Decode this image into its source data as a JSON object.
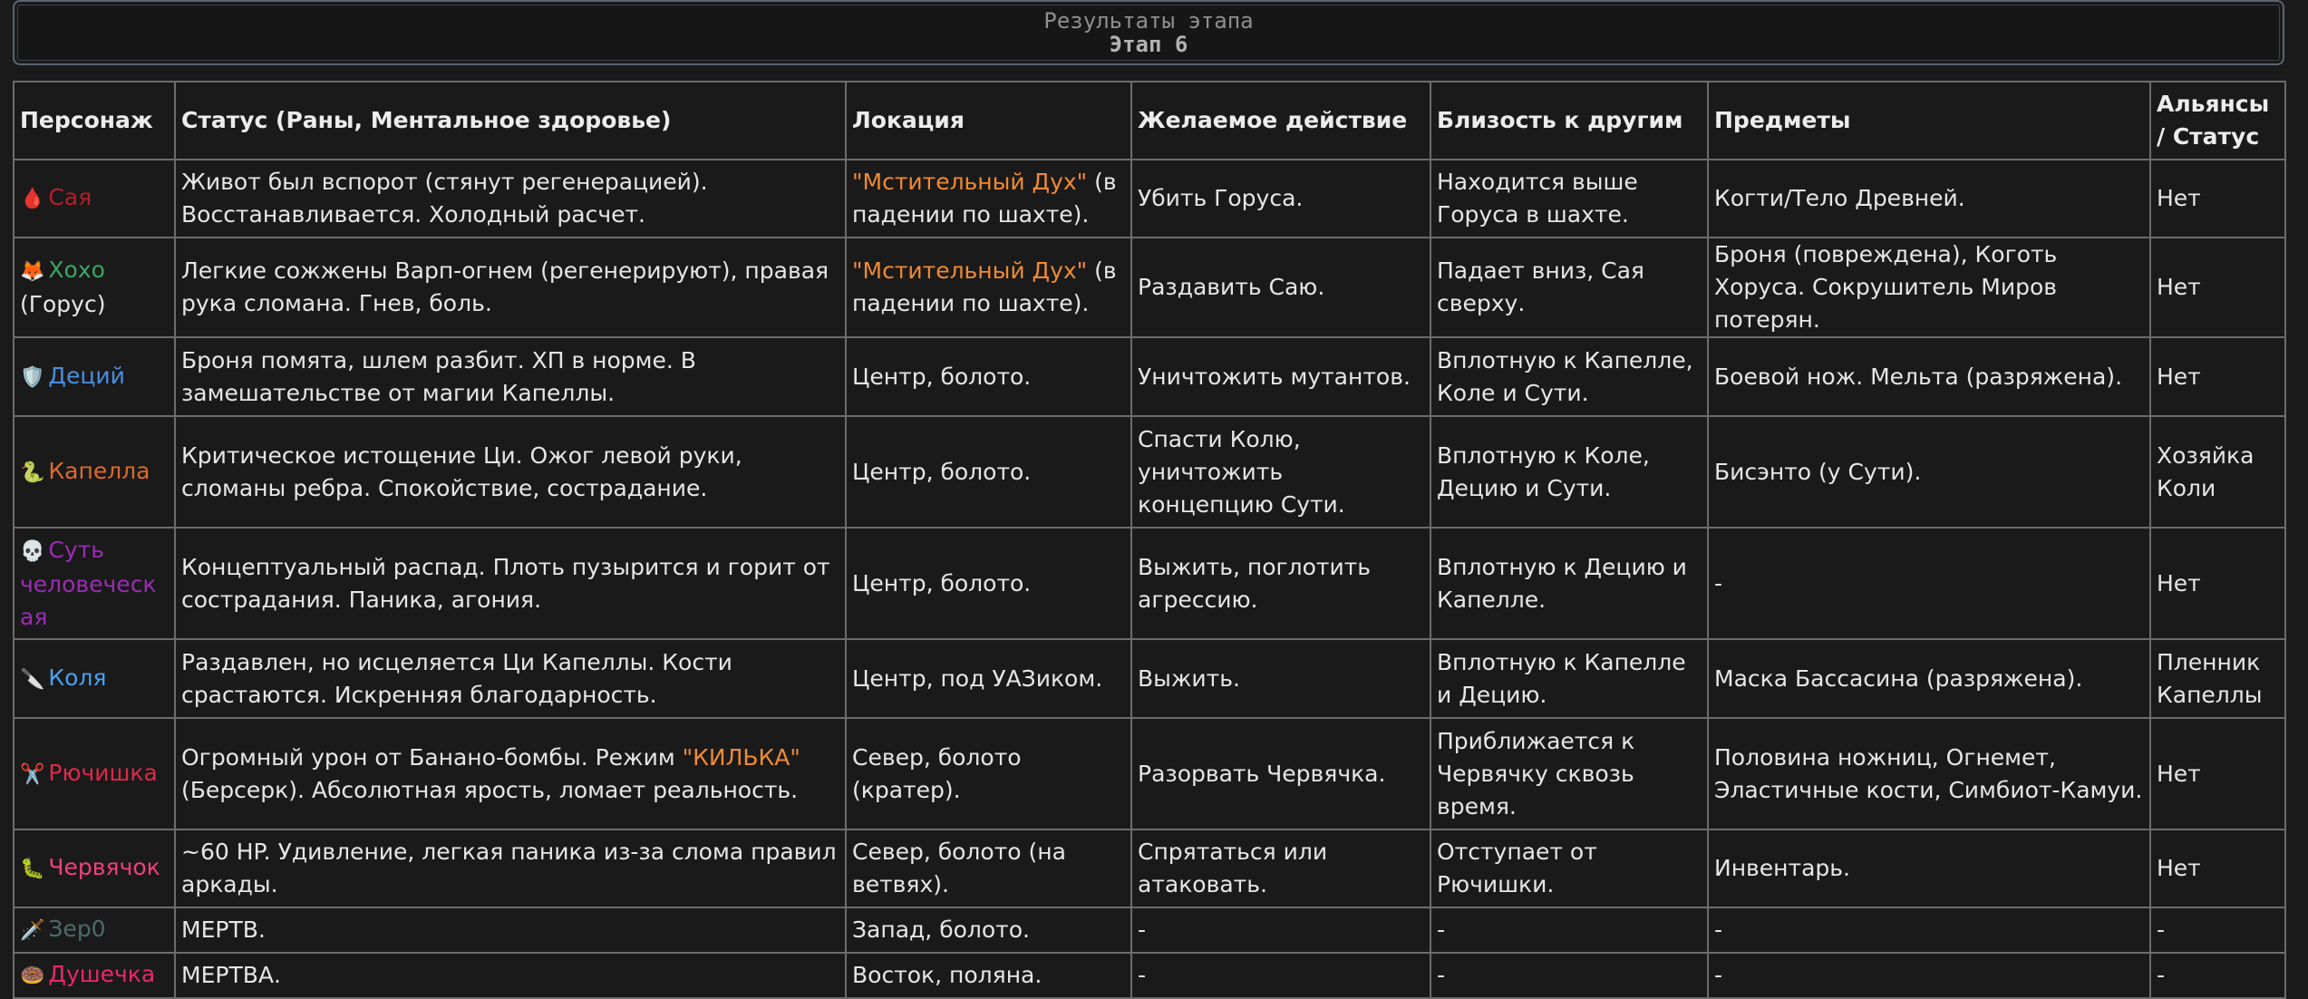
{
  "banner": {
    "title": "Результаты этапа",
    "stage": "Этап 6"
  },
  "columns": [
    "Персонаж",
    "Статус (Раны, Ментальное здоровье)",
    "Локация",
    "Желаемое действие",
    "Близость к другим",
    "Предметы",
    "Альянсы / Статус"
  ],
  "colors": {
    "background": "#1a1a1a",
    "highlight": "#f08a33",
    "sayа": "#b81c2a",
    "hoho": "#3ba661",
    "decius": "#4a8fe0",
    "kapella": "#dd6a2a",
    "sut": "#9b2db3",
    "kolya": "#4aa0f0",
    "ryuchishka": "#e0284a",
    "chervyachok": "#f0407a",
    "zer0": "#4d6a6a",
    "dushechka": "#e8286a"
  },
  "rows": [
    {
      "emoji": "🩸",
      "icon": "blood-drop-icon",
      "name": "Сая",
      "name_suffix": "",
      "status": "Живот был вспорот (стянут регенерацией). Восстанавливается. Холодный расчет.",
      "location_highlight": "\"Мстительный Дух\"",
      "location": " (в падении по шахте).",
      "action": "Убить Горуса.",
      "proximity": "Находится выше Горуса в шахте.",
      "items": "Когти/Тело Древней.",
      "alliance": "Нет"
    },
    {
      "emoji": "🦊",
      "icon": "fox-icon",
      "name": "Хохо",
      "name_suffix": "(Горус)",
      "status": "Легкие сожжены Варп-огнем (регенерируют), правая рука сломана. Гнев, боль.",
      "location_highlight": "\"Мстительный Дух\"",
      "location": " (в падении по шахте).",
      "action": "Раздавить Саю.",
      "proximity": "Падает вниз, Сая сверху.",
      "items": "Броня (повреждена), Коготь Хоруса. Сокрушитель Миров потерян.",
      "alliance": "Нет"
    },
    {
      "emoji": "🛡️",
      "icon": "shield-icon",
      "name": "Деций",
      "name_suffix": "",
      "status": "Броня помята, шлем разбит. ХП в норме. В замешательстве от магии Капеллы.",
      "location_highlight": "",
      "location": "Центр, болото.",
      "action": "Уничтожить мутантов.",
      "proximity": "Вплотную к Капелле, Коле и Сути.",
      "items": "Боевой нож. Мельта (разряжена).",
      "alliance": "Нет"
    },
    {
      "emoji": "🐍",
      "icon": "snake-icon",
      "name": "Капелла",
      "name_suffix": "",
      "status": "Критическое истощение Ци. Ожог левой руки, сломаны ребра. Спокойствие, сострадание.",
      "location_highlight": "",
      "location": "Центр, болото.",
      "action": "Спасти Колю, уничтожить концепцию Сути.",
      "proximity": "Вплотную к Коле, Децию и Сути.",
      "items": "Бисэнто (у Сути).",
      "alliance": "Хозяйка Коли"
    },
    {
      "emoji": "💀",
      "icon": "skull-icon",
      "name": "Суть человеческая",
      "name_suffix": "",
      "status": "Концептуальный распад. Плоть пузырится и горит от сострадания. Паника, агония.",
      "location_highlight": "",
      "location": "Центр, болото.",
      "action": "Выжить, поглотить агрессию.",
      "proximity": "Вплотную к Децию и Капелле.",
      "items": "-",
      "alliance": "Нет"
    },
    {
      "emoji": "🔪",
      "icon": "knife-icon",
      "name": "Коля",
      "name_suffix": "",
      "status": "Раздавлен, но исцеляется Ци Капеллы. Кости срастаются. Искренняя благодарность.",
      "location_highlight": "",
      "location": "Центр, под УАЗиком.",
      "action": "Выжить.",
      "proximity": "Вплотную к Капелле и Децию.",
      "items": "Маска Бассасина (разряжена).",
      "alliance": "Пленник Капеллы"
    },
    {
      "emoji": "✂️",
      "icon": "scissors-icon",
      "name": "Рючишка",
      "name_suffix": "",
      "status_pre": "Огромный урон от Банано-бомбы. Режим ",
      "status_highlight": "\"КИЛЬКА\"",
      "status": " (Берсерк). Абсолютная ярость, ломает реальность.",
      "location_highlight": "",
      "location": "Север, болото (кратер).",
      "action": "Разорвать Червячка.",
      "proximity": "Приближается к Червячку сквозь время.",
      "items": "Половина ножниц, Огнемет, Эластичные кости, Симбиот-Камуи.",
      "alliance": "Нет"
    },
    {
      "emoji": "🐛",
      "icon": "worm-icon",
      "name": "Червячок",
      "name_suffix": "",
      "status": "~60 HP. Удивление, легкая паника из-за слома правил аркады.",
      "location_highlight": "",
      "location": "Север, болото (на ветвях).",
      "action": "Спрятаться или атаковать.",
      "proximity": "Отступает от Рючишки.",
      "items": "Инвентарь.",
      "alliance": "Нет"
    },
    {
      "emoji": "🗡️",
      "icon": "dagger-icon",
      "name": "Зер0",
      "name_suffix": "",
      "status": "МЕРТВ.",
      "location_highlight": "",
      "location": "Запад, болото.",
      "action": "-",
      "proximity": "-",
      "items": "-",
      "alliance": "-"
    },
    {
      "emoji": "🍩",
      "icon": "donut-icon",
      "name": "Душечка",
      "name_suffix": "",
      "status": "МЕРТВА.",
      "location_highlight": "",
      "location": "Восток, поляна.",
      "action": "-",
      "proximity": "-",
      "items": "-",
      "alliance": "-"
    }
  ]
}
